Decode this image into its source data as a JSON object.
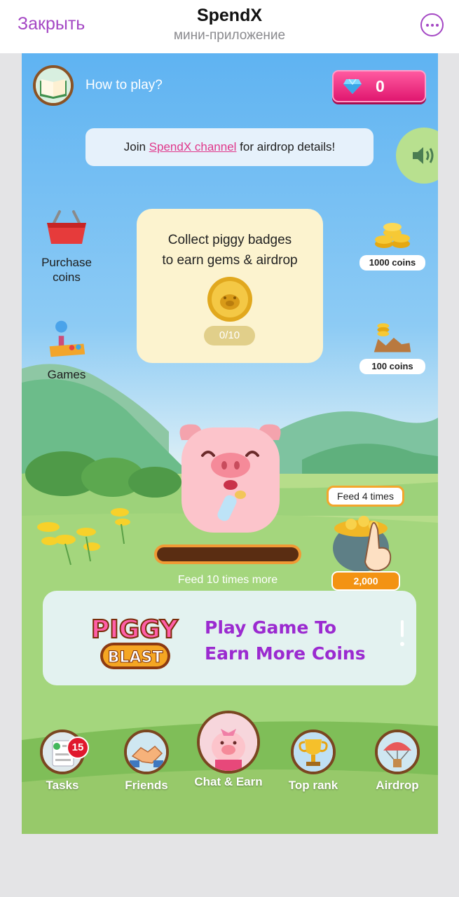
{
  "header": {
    "close_label": "Закрыть",
    "title": "SpendX",
    "subtitle": "мини-приложение"
  },
  "game": {
    "how_to_play": "How to play?",
    "gems": "0",
    "join_banner": {
      "prefix": "Join ",
      "link": "SpendX channel",
      "suffix": " for airdrop details!"
    },
    "side_left": [
      {
        "label_line1": "Purchase",
        "label_line2": "coins",
        "icon": "basket-icon"
      },
      {
        "label_line1": "Games",
        "label_line2": "",
        "icon": "joystick-icon"
      }
    ],
    "side_right": [
      {
        "label": "1000 coins",
        "icon": "coin-stack-icon"
      },
      {
        "label": "100 coins",
        "icon": "coin-chart-icon"
      }
    ],
    "badge_card": {
      "line1": "Collect piggy badges",
      "line2": "to earn gems & airdrop",
      "progress": "0/10"
    },
    "feed": {
      "more_label": "Feed 10 times more",
      "times_label": "Feed 4 times",
      "cost": "2,000",
      "progress": 0
    },
    "promo": {
      "logo_top": "PIGGY",
      "logo_bottom": "BLAST",
      "line1": "Play Game To",
      "line2": "Earn More Coins"
    },
    "nav": [
      {
        "label": "Tasks",
        "icon": "checklist-icon",
        "badge": "15"
      },
      {
        "label": "Friends",
        "icon": "handshake-icon"
      },
      {
        "label": "Chat & Earn",
        "icon": "pig-avatar-icon"
      },
      {
        "label": "Top rank",
        "icon": "trophy-icon"
      },
      {
        "label": "Airdrop",
        "icon": "parachute-icon"
      }
    ],
    "colors": {
      "accent": "#a447c4",
      "gem_box": "#e0176f",
      "link": "#e0378a",
      "promo_text": "#9b2ad0",
      "feed_bar": "#f09a35"
    }
  }
}
